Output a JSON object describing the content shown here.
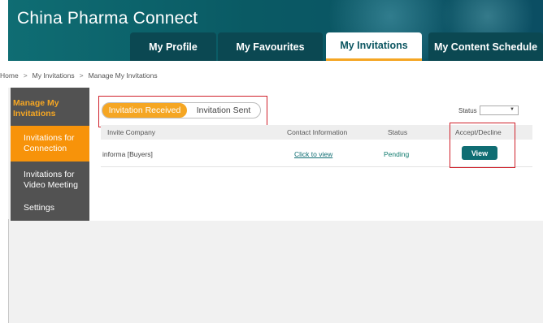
{
  "header": {
    "brand": "China Pharma Connect",
    "accent": "#f5a623",
    "theme": "#0f6d73"
  },
  "nav": {
    "tabs": [
      {
        "label": "My Profile",
        "active": false
      },
      {
        "label": "My Favourites",
        "active": false
      },
      {
        "label": "My Invitations",
        "active": true
      },
      {
        "label": "My Content Schedule",
        "active": false
      }
    ]
  },
  "breadcrumb": {
    "items": [
      "Home",
      "My Invitations",
      "Manage My Invitations"
    ],
    "separator": ">"
  },
  "sidebar": {
    "title": "Manage My Invitations",
    "items": [
      {
        "label": "Invitations for Connection",
        "active": true
      },
      {
        "label": "Invitations for Video Meeting",
        "active": false
      },
      {
        "label": "Settings",
        "active": false
      }
    ]
  },
  "main": {
    "toggle": {
      "received": "Invitation Received",
      "sent": "Invitation Sent",
      "active": "received"
    },
    "status_filter": {
      "label": "Status",
      "value": ""
    },
    "table": {
      "headers": [
        "Invite Company",
        "Contact Information",
        "Status",
        "Accept/Decline"
      ],
      "rows": [
        {
          "company": "informa [Buyers]",
          "contact": "Click to view",
          "status": "Pending",
          "action": "View"
        }
      ]
    }
  }
}
